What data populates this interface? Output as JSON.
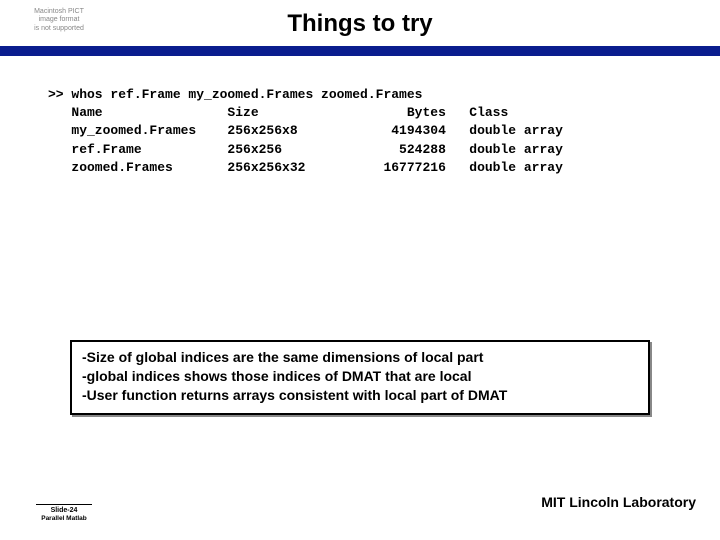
{
  "header": {
    "title": "Things to try",
    "pict_placeholder_l1": "Macintosh PICT",
    "pict_placeholder_l2": "image format",
    "pict_placeholder_l3": "is not supported"
  },
  "code": {
    "command": ">> whos ref.Frame my_zoomed.Frames zoomed.Frames",
    "columns": {
      "name": "Name",
      "size": "Size",
      "bytes": "Bytes",
      "class": "Class"
    },
    "rows": [
      {
        "name": "my_zoomed.Frames",
        "size": "256x256x8",
        "bytes": "4194304",
        "class": "double array"
      },
      {
        "name": "ref.Frame",
        "size": "256x256",
        "bytes": "524288",
        "class": "double array"
      },
      {
        "name": "zoomed.Frames",
        "size": "256x256x32",
        "bytes": "16777216",
        "class": "double array"
      }
    ]
  },
  "notes": {
    "line1": "-Size of global indices are the same dimensions of local part",
    "line2": "-global indices shows those indices of DMAT that are local",
    "line3": "-User function returns arrays consistent with local part of DMAT"
  },
  "footer": {
    "slide": "Slide-24",
    "subtitle": "Parallel Matlab",
    "org": "MIT Lincoln Laboratory"
  }
}
